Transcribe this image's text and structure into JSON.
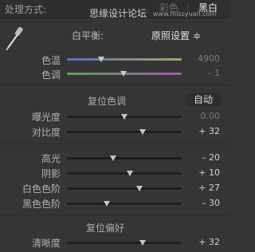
{
  "header": {
    "process_label": "处理方式:",
    "watermark": "思缘设计论坛",
    "watermark_url": "www.missyuan.com",
    "option_color": "彩色",
    "option_bw": "黑白"
  },
  "white_balance": {
    "label": "白平衡:",
    "value": "原照设置 ≑"
  },
  "wb_sliders": [
    {
      "label": "色温",
      "value": "4900",
      "level": 0.3
    },
    {
      "label": "色调",
      "value": "– 1",
      "level": 0.49
    }
  ],
  "tone": {
    "title": "复位色调",
    "auto": "自动",
    "sliders": [
      {
        "label": "曝光度",
        "value": "0.00",
        "level": 0.5
      },
      {
        "label": "对比度",
        "value": "+ 32",
        "level": 0.66
      }
    ]
  },
  "tone2": {
    "sliders": [
      {
        "label": "高光",
        "value": "– 20",
        "level": 0.4
      },
      {
        "label": "阴影",
        "value": "+ 10",
        "level": 0.55
      },
      {
        "label": "白色色阶",
        "value": "+ 27",
        "level": 0.63
      },
      {
        "label": "黑色色阶",
        "value": "– 30",
        "level": 0.35
      }
    ]
  },
  "presence": {
    "title": "复位偏好",
    "sliders": [
      {
        "label": "清晰度",
        "value": "+ 32",
        "level": 0.66
      }
    ]
  }
}
